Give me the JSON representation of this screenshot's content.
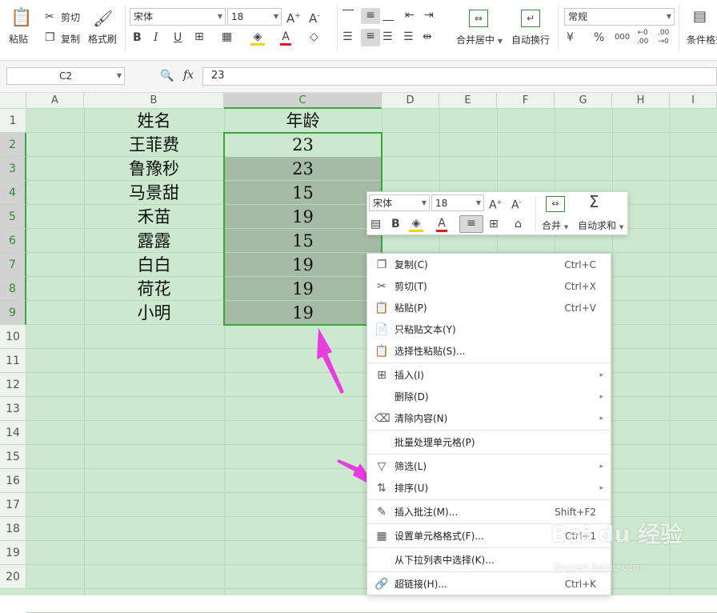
{
  "ribbon": {
    "paste": "粘贴",
    "cut": "剪切",
    "copy": "复制",
    "format_painter": "格式刷",
    "font_name": "宋体",
    "font_size": "18",
    "merge_center": "合并居中",
    "wrap_text": "自动换行",
    "number_format": "常规",
    "conditional_format": "条件格式"
  },
  "formula_bar": {
    "name_box": "C2",
    "fx": "fx",
    "value": "23"
  },
  "columns": [
    "A",
    "B",
    "C",
    "D",
    "E",
    "F",
    "G",
    "H",
    "I"
  ],
  "rows": [
    "1",
    "2",
    "3",
    "4",
    "5",
    "6",
    "7",
    "8",
    "9",
    "10",
    "11",
    "12",
    "13",
    "14",
    "15",
    "16",
    "17",
    "18",
    "19",
    "20"
  ],
  "cells": {
    "names": [
      "姓名",
      "王菲费",
      "鲁豫秒",
      "马景甜",
      "禾苗",
      "露露",
      "白白",
      "荷花",
      "小明"
    ],
    "ages": [
      "年龄",
      "23",
      "23",
      "15",
      "19",
      "15",
      "19",
      "19",
      "19"
    ]
  },
  "mini_toolbar": {
    "font_name": "宋体",
    "font_size": "18",
    "merge": "合并",
    "autosum": "自动求和"
  },
  "context_menu": [
    {
      "label": "复制(C)",
      "shortcut": "Ctrl+C",
      "icon": "copy-icon"
    },
    {
      "label": "剪切(T)",
      "shortcut": "Ctrl+X",
      "icon": "scissors-icon"
    },
    {
      "label": "粘贴(P)",
      "shortcut": "Ctrl+V",
      "icon": "paste-icon"
    },
    {
      "label": "只粘贴文本(Y)",
      "shortcut": "",
      "icon": "paste-text-icon"
    },
    {
      "label": "选择性粘贴(S)...",
      "shortcut": "",
      "icon": "paste-special-icon"
    },
    {
      "label": "插入(I)",
      "shortcut": "",
      "icon": "insert-icon"
    },
    {
      "label": "删除(D)",
      "shortcut": "",
      "icon": ""
    },
    {
      "label": "清除内容(N)",
      "shortcut": "",
      "icon": "eraser-icon"
    },
    {
      "label": "批量处理单元格(P)",
      "shortcut": "",
      "icon": ""
    },
    {
      "label": "筛选(L)",
      "shortcut": "",
      "icon": "filter-icon"
    },
    {
      "label": "排序(U)",
      "shortcut": "",
      "icon": "sort-az-icon"
    },
    {
      "label": "插入批注(M)...",
      "shortcut": "Shift+F2",
      "icon": "comment-icon"
    },
    {
      "label": "设置单元格格式(F)...",
      "shortcut": "Ctrl+1",
      "icon": "format-cells-icon"
    },
    {
      "label": "从下拉列表中选择(K)...",
      "shortcut": "",
      "icon": ""
    },
    {
      "label": "超链接(H)...",
      "shortcut": "Ctrl+K",
      "icon": "link-icon"
    }
  ],
  "watermark": {
    "brand": "Bai du 经验",
    "url": "jingyan.baidu.com"
  },
  "colors": {
    "grid_bg": "#cce8cf",
    "selection_border": "#3aa63f",
    "annotation_arrow": "#e83be0"
  }
}
